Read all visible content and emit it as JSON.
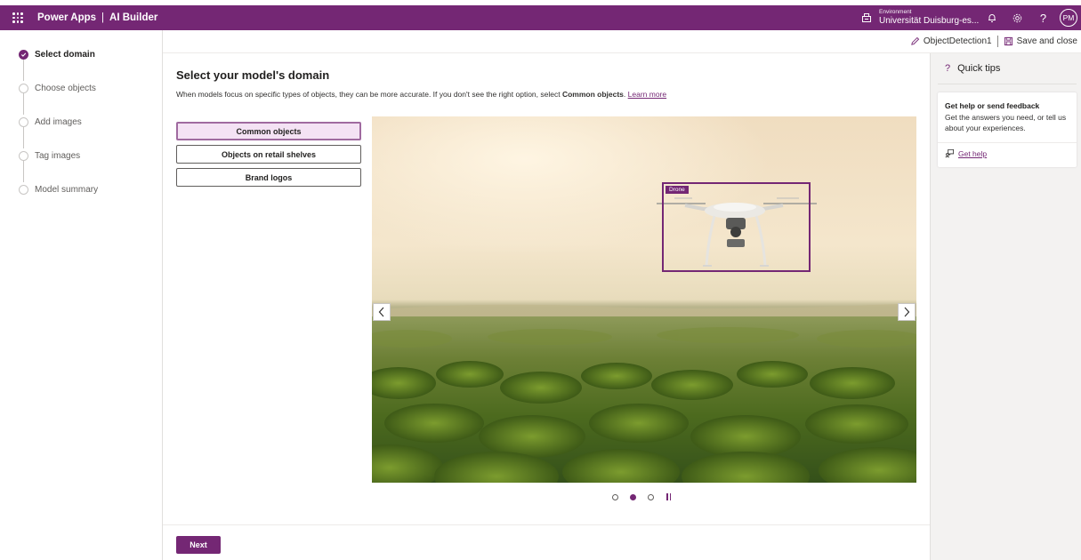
{
  "header": {
    "app_name": "Power Apps",
    "app_separator": "|",
    "product": "AI Builder",
    "environment_label": "Environment",
    "environment_value": "Universität Duisburg-es...",
    "help_glyph": "?",
    "user_initials": "PM",
    "icons": [
      "waffle-icon",
      "environment-icon",
      "bell-icon",
      "gear-icon",
      "help-icon"
    ]
  },
  "steps": [
    {
      "label": "Select domain",
      "active": true
    },
    {
      "label": "Choose objects",
      "active": false
    },
    {
      "label": "Add images",
      "active": false
    },
    {
      "label": "Tag images",
      "active": false
    },
    {
      "label": "Model summary",
      "active": false
    }
  ],
  "commandbar": {
    "model_name": "ObjectDetection1",
    "save_close": "Save and close"
  },
  "main": {
    "title": "Select your model's domain",
    "description_prefix": "When models focus on specific types of objects, they can be more accurate. If you don't see the right option, select ",
    "description_bold": "Common objects",
    "description_suffix": ". ",
    "learn_more": "Learn more",
    "domains": [
      {
        "label": "Common objects",
        "selected": true
      },
      {
        "label": "Objects on retail shelves",
        "selected": false
      },
      {
        "label": "Brand logos",
        "selected": false
      }
    ],
    "carousel": {
      "detection_label": "Drone",
      "current_slide": 2,
      "slide_count": 3
    },
    "next_label": "Next"
  },
  "quick_tips": {
    "icon_glyph": "?",
    "title": "Quick tips",
    "card_title": "Get help or send feedback",
    "card_body": "Get the answers you need, or tell us about your experiences.",
    "link_label": "Get help"
  },
  "colors": {
    "brand": "#742774",
    "selected_bg": "#f4e2f4",
    "panel_bg": "#f3f2f1"
  }
}
